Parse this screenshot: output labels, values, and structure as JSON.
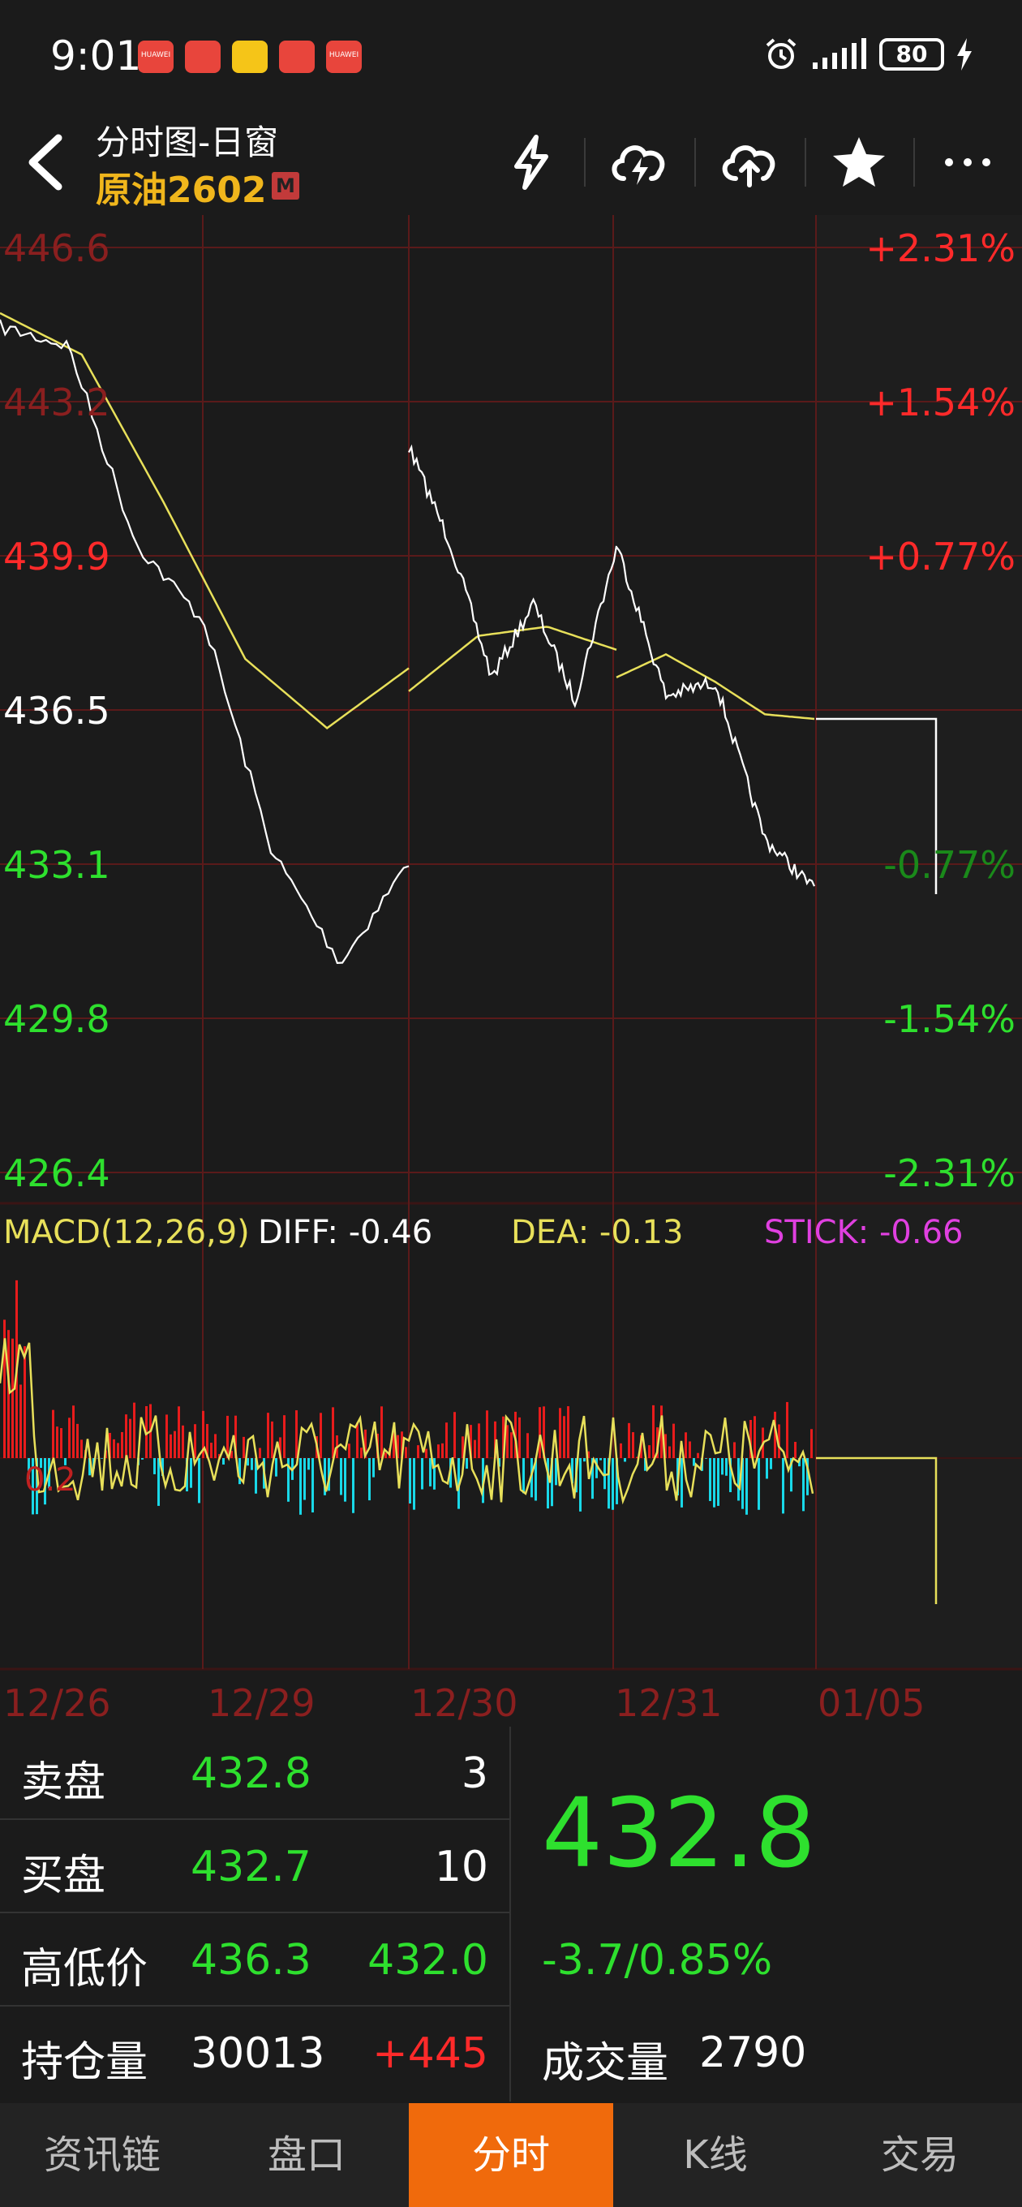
{
  "status_bar": {
    "time": "9:01",
    "notifications": [
      {
        "icon": "huawei-app-icon",
        "label": "HUAWEI",
        "color": "#e8453c"
      },
      {
        "icon": "app-icon",
        "label": "",
        "color": "#e8453c"
      },
      {
        "icon": "promo-app-icon",
        "label": "",
        "color": "#f5c518"
      },
      {
        "icon": "app-icon",
        "label": "",
        "color": "#e8453c"
      },
      {
        "icon": "huawei-app-icon",
        "label": "HUAWEI",
        "color": "#e8453c"
      }
    ],
    "battery": "80"
  },
  "header": {
    "title": "分时图-日窗",
    "instrument": "原油2602",
    "badge": "M",
    "actions": [
      "flash-icon",
      "cloud-flash-icon",
      "cloud-upload-icon",
      "star-icon",
      "more-icon"
    ]
  },
  "chart_labels": {
    "price_ticks": [
      "446.6",
      "443.2",
      "439.9",
      "436.5",
      "433.1",
      "429.8",
      "426.4"
    ],
    "pct_ticks": [
      "+2.31%",
      "+1.54%",
      "+0.77%",
      "",
      "-0.77%",
      "-1.54%",
      "-2.31%"
    ],
    "macd_title": "MACD(12,26,9)",
    "macd_diff": "DIFF: -0.46",
    "macd_dea": "DEA: -0.13",
    "macd_stick": "STICK: -0.66",
    "macd_axis": "0.2",
    "dates": [
      "12/26",
      "12/29",
      "12/30",
      "12/31",
      "01/05"
    ]
  },
  "chart_data": {
    "type": "line",
    "title": "",
    "x": [
      "12/26",
      "12/29",
      "12/30",
      "12/31",
      "01/05"
    ],
    "ylim": [
      426.4,
      446.6
    ],
    "reference_price": 436.5,
    "series": [
      {
        "values": [
          445.0,
          444.6,
          440.3,
          438.6,
          433.6,
          431.2,
          433.4,
          442.4,
          440.3,
          437.4,
          439.0,
          436.9,
          440.2,
          440.3,
          437.0,
          437.3,
          433.9,
          432.8
        ]
      },
      {
        "values": [
          445.3,
          444.4,
          441.2,
          437.8,
          436.3,
          437.6,
          437.1,
          438.3,
          438.5,
          438.0,
          437.4,
          437.9,
          437.3,
          436.6,
          436.5
        ]
      }
    ],
    "macd": {
      "diff": -0.46,
      "dea": -0.13,
      "stick": -0.66
    }
  },
  "quotes": {
    "ask_label": "卖盘",
    "ask_price": "432.8",
    "ask_vol": "3",
    "bid_label": "买盘",
    "bid_price": "432.7",
    "bid_vol": "10",
    "hl_label": "高低价",
    "high": "436.3",
    "low": "432.0",
    "oi_label": "持仓量",
    "oi": "30013",
    "oi_change": "+445",
    "last_price": "432.8",
    "change": "-3.7/0.85%",
    "volume_label": "成交量",
    "volume": "2790"
  },
  "tabs": [
    "资讯链",
    "盘口",
    "分时",
    "K线",
    "交易"
  ],
  "active_tab": 2,
  "colors": {
    "up": "#ff2a2a",
    "down": "#2ee02e",
    "price_line": "#ffffff",
    "avg_line": "#e8e05a",
    "grid": "#5a1a1a",
    "accent": "#f06a0c",
    "title": "#f0b61c",
    "macd_pos": "#e81c1c",
    "macd_neg": "#19d8e8",
    "stick": "#e040e0"
  }
}
